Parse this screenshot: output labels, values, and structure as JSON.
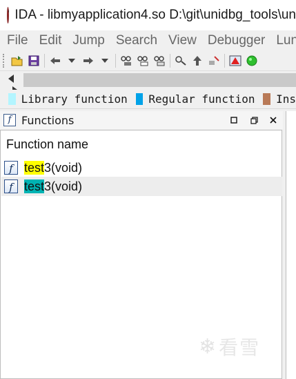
{
  "window": {
    "title": "IDA - libmyapplication4.so D:\\git\\unidbg_tools\\un"
  },
  "menubar": {
    "items": [
      "File",
      "Edit",
      "Jump",
      "Search",
      "View",
      "Debugger",
      "Lun"
    ]
  },
  "toolbar": {
    "icons": [
      "open-icon",
      "save-icon",
      "back-icon",
      "dropdown-icon",
      "forward-icon",
      "dropdown-icon",
      "binary-search-icon",
      "text-search-icon",
      "immediate-search-icon",
      "jump-icon",
      "up-icon",
      "graph-icon",
      "warning-icon",
      "run-icon"
    ]
  },
  "legend": {
    "items": [
      {
        "label": "Library function",
        "color": "#b3f5ff"
      },
      {
        "label": "Regular function",
        "color": "#00a2e8"
      },
      {
        "label": "Ins",
        "color": "#b97a57"
      }
    ]
  },
  "functions_panel": {
    "title": "Functions",
    "column_header": "Function name",
    "rows": [
      {
        "highlight": "test",
        "rest": "3(void)",
        "highlight_color": "#ffff00",
        "selected": false
      },
      {
        "highlight": "test",
        "rest": "3(void)",
        "highlight_color": "#00b3b3",
        "selected": true
      }
    ]
  },
  "watermark": {
    "text": "看雪"
  }
}
